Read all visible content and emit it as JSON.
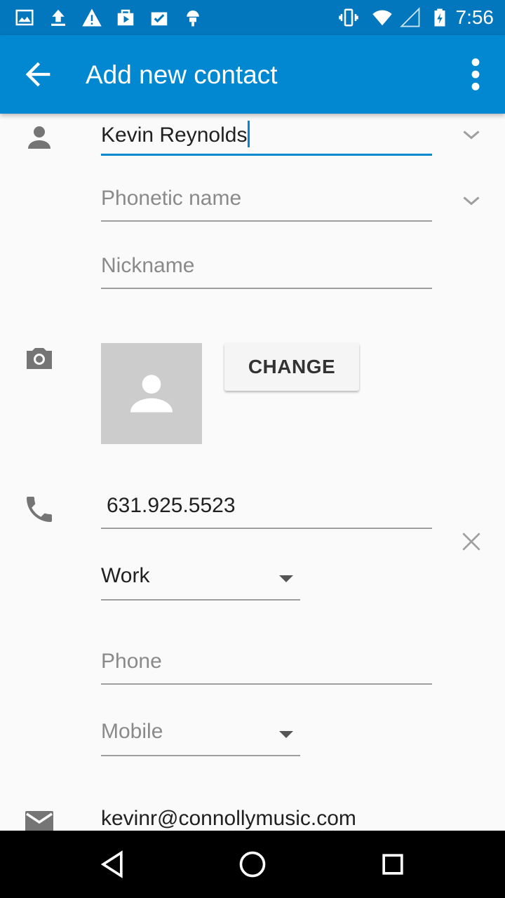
{
  "status_bar": {
    "time": "7:56",
    "icons": [
      "image-icon",
      "upload-icon",
      "warning-icon",
      "play-store-icon",
      "task-check-icon",
      "android-icon",
      "vibrate-icon",
      "wifi-icon",
      "signal-icon",
      "battery-charging-icon"
    ]
  },
  "app_bar": {
    "title": "Add new contact",
    "back_icon": "arrow-back-icon",
    "menu_icon": "more-vert-icon"
  },
  "form": {
    "name": {
      "value": "Kevin Reynolds",
      "icon": "person-icon"
    },
    "phonetic_name": {
      "placeholder": "Phonetic name"
    },
    "nickname": {
      "placeholder": "Nickname"
    },
    "photo": {
      "icon": "camera-icon",
      "change_label": "CHANGE"
    },
    "phone1": {
      "value": "631.925.5523",
      "type": "Work",
      "icon": "phone-icon"
    },
    "phone2": {
      "placeholder": "Phone",
      "type": "Mobile"
    },
    "email": {
      "value": "kevinr@connollymusic.com",
      "icon": "email-icon"
    }
  },
  "colors": {
    "status_bar": "#0277bd",
    "app_bar": "#0288d1",
    "accent": "#0288d1",
    "background": "#fafafa"
  }
}
